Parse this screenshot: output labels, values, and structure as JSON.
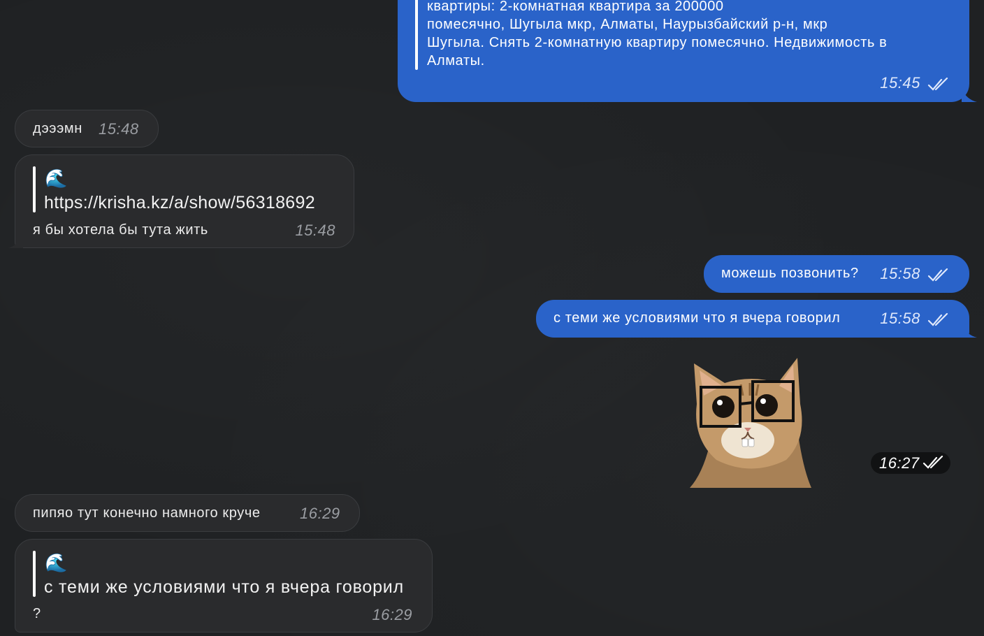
{
  "messages": {
    "m1": {
      "text": "квартиры: 2-комнатная квартира за 200000\nпомесячно, Шугыла мкр, Алматы, Наурызбайский р-н, мкр\nШугыла. Снять 2-комнатную квартиру помесячно. Недвижимость в\nАлматы.",
      "time": "15:45"
    },
    "m2": {
      "text": "дэээмн",
      "time": "15:48"
    },
    "m3": {
      "quote_emoji": "🌊",
      "quote_text": "https://krisha.kz/a/show/56318692",
      "text": "я бы хотела бы тута жить",
      "time": "15:48"
    },
    "m4": {
      "text": "можешь позвонить?",
      "time": "15:58"
    },
    "m5": {
      "text": "с теми же условиями что я вчера говорил",
      "time": "15:58"
    },
    "m6": {
      "sticker": "cat-with-glasses-sticker",
      "time": "16:27"
    },
    "m7": {
      "text": "пипяо тут конечно намного круче",
      "time": "16:29"
    },
    "m8": {
      "quote_emoji": "🌊",
      "quote_text": "с теми же условиями что я вчера говорил",
      "text": "?",
      "time": "16:29"
    }
  },
  "icons": {
    "read": "double-check-icon"
  },
  "colors": {
    "outgoing": "#2a63c9",
    "incoming": "#2a2b2d",
    "background": "#1f2123"
  }
}
